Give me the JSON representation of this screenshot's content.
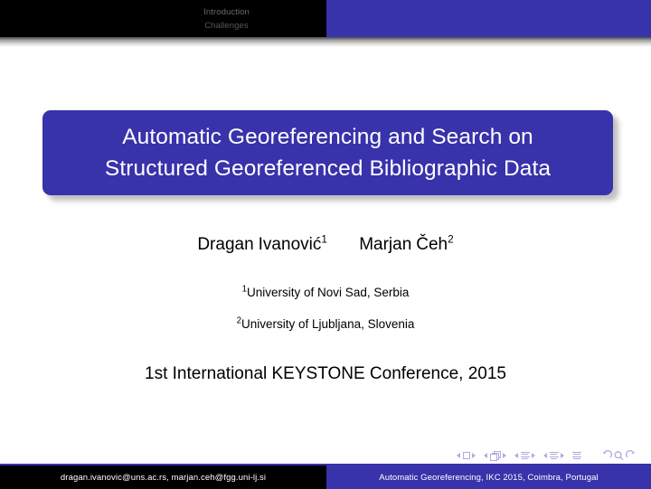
{
  "colors": {
    "accent_blue": "#3832ab",
    "header_bar": "#000000",
    "nav_text": "#585858",
    "nav_symbol": "#4b48c0",
    "title_text": "#ffffff",
    "body_text": "#000000"
  },
  "header": {
    "nav_items": [
      {
        "label": "Introduction"
      },
      {
        "label": "Challenges"
      }
    ]
  },
  "title": {
    "line1": "Automatic Georeferencing and Search on",
    "line2": "Structured Georeferenced Bibliographic Data"
  },
  "authors": [
    {
      "first": "Dragan",
      "last": "Ivanović",
      "affil_marker": "1"
    },
    {
      "first": "Marjan",
      "last": "Čeh",
      "affil_marker": "2"
    }
  ],
  "affiliations": [
    {
      "marker": "1",
      "name": "University of Novi Sad, Serbia"
    },
    {
      "marker": "2",
      "name": "University of Ljubljana, Slovenia"
    }
  ],
  "conference": "1st International KEYSTONE Conference, 2015",
  "navigation_symbols": [
    {
      "name": "slide-navigation",
      "icon": "square"
    },
    {
      "name": "frame-navigation",
      "icon": "stacked-frames"
    },
    {
      "name": "subsection-navigation",
      "icon": "lines"
    },
    {
      "name": "section-navigation",
      "icon": "lines"
    },
    {
      "name": "document-navigation",
      "icon": "lines"
    },
    {
      "name": "back-arrow",
      "icon": "arc-back"
    },
    {
      "name": "search",
      "icon": "magnifier"
    },
    {
      "name": "forward-arrow",
      "icon": "arc-forward"
    }
  ],
  "footer": {
    "left": "dragan.ivanovic@uns.ac.rs, marjan.ceh@fgg.uni-lj.si",
    "right": "Automatic Georeferencing, IKC 2015, Coimbra, Portugal"
  }
}
